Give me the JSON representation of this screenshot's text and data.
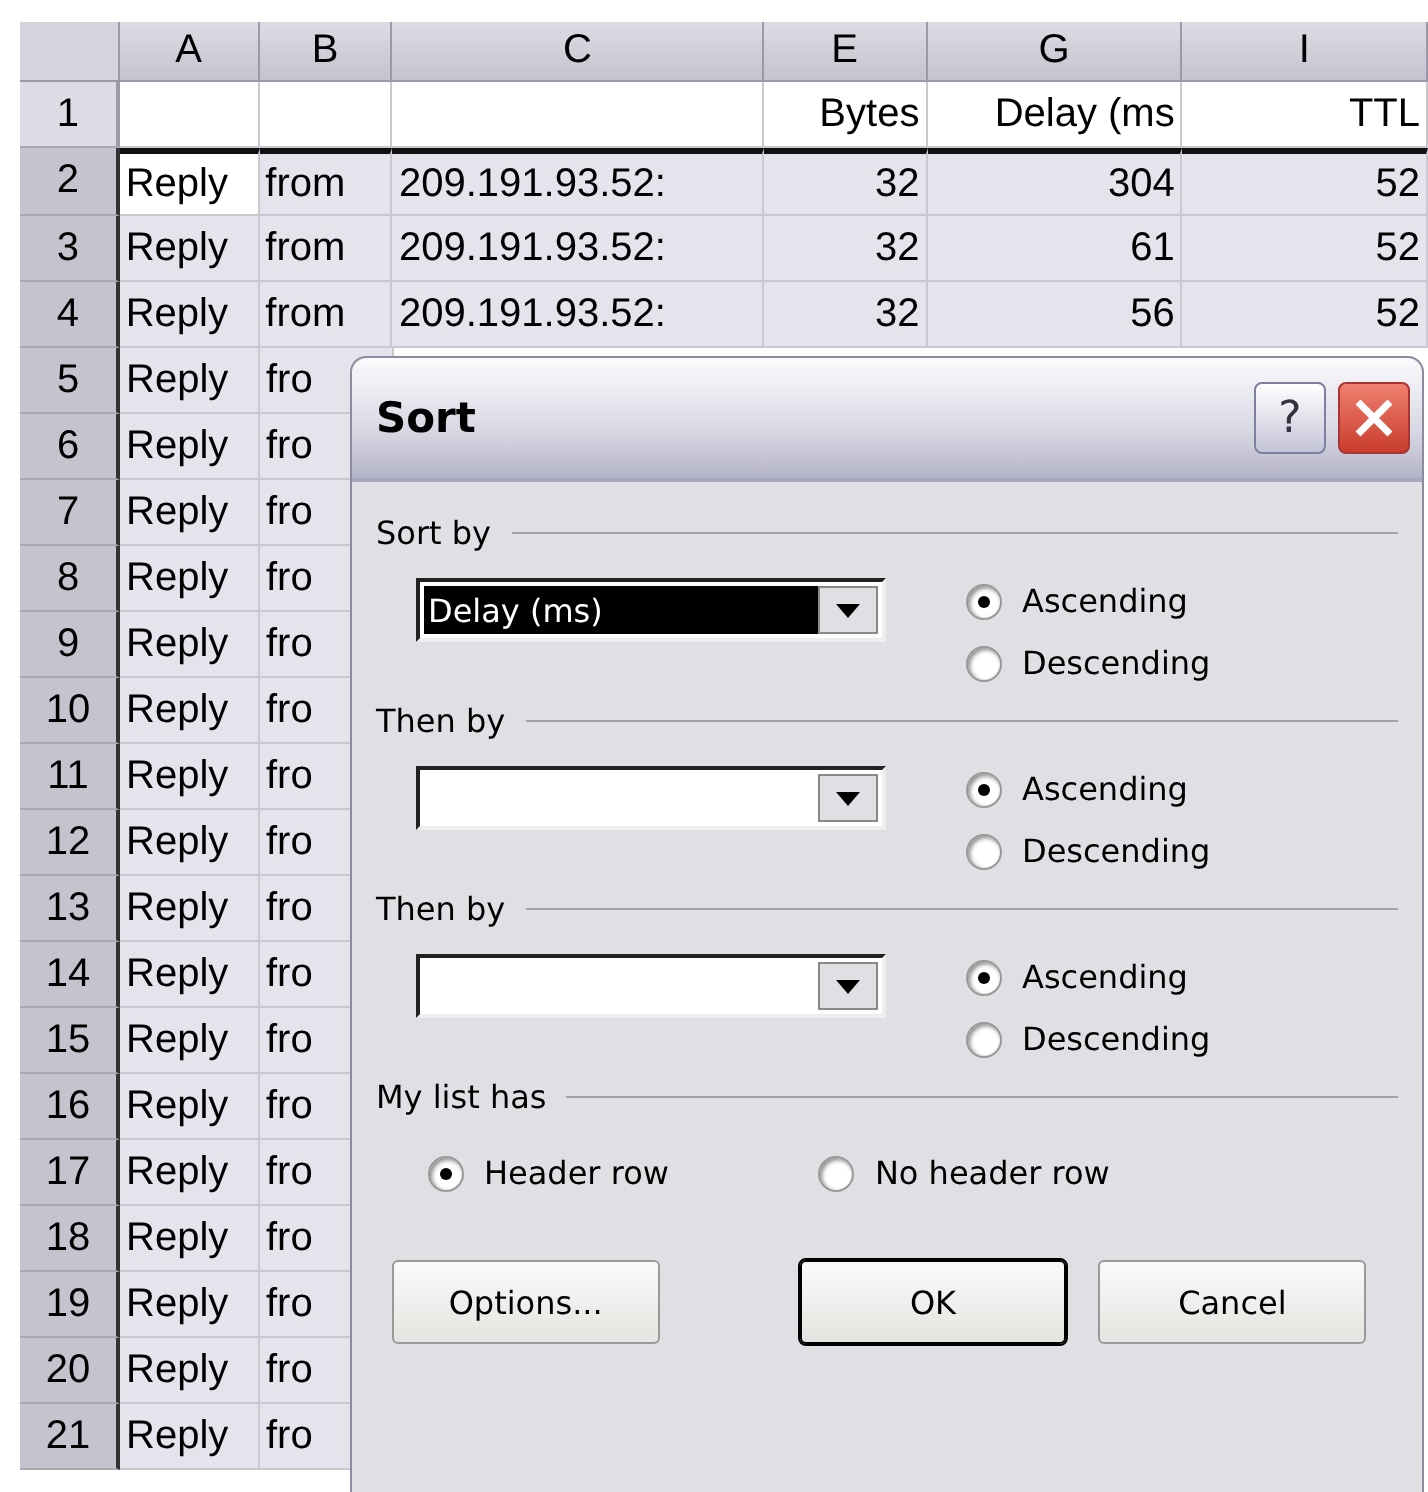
{
  "sheet": {
    "columns": [
      "A",
      "B",
      "C",
      "E",
      "G",
      "I"
    ],
    "rows": [
      {
        "number": "1",
        "selected": false,
        "cells": [
          null,
          null,
          null,
          "Bytes",
          "Delay (ms",
          "TTL"
        ]
      },
      {
        "number": "2",
        "selected": true,
        "active": true,
        "cells": [
          "Reply",
          "from",
          "209.191.93.52:",
          "32",
          "304",
          "52"
        ]
      },
      {
        "number": "3",
        "selected": true,
        "cells": [
          "Reply",
          "from",
          "209.191.93.52:",
          "32",
          "61",
          "52"
        ]
      },
      {
        "number": "4",
        "selected": true,
        "cells": [
          "Reply",
          "from",
          "209.191.93.52:",
          "32",
          "56",
          "52"
        ]
      },
      {
        "number": "5",
        "selected": true,
        "cells": [
          "Reply",
          "fro"
        ]
      },
      {
        "number": "6",
        "selected": true,
        "cells": [
          "Reply",
          "fro"
        ]
      },
      {
        "number": "7",
        "selected": true,
        "cells": [
          "Reply",
          "fro"
        ]
      },
      {
        "number": "8",
        "selected": true,
        "cells": [
          "Reply",
          "fro"
        ]
      },
      {
        "number": "9",
        "selected": true,
        "cells": [
          "Reply",
          "fro"
        ]
      },
      {
        "number": "10",
        "selected": true,
        "cells": [
          "Reply",
          "fro"
        ]
      },
      {
        "number": "11",
        "selected": true,
        "cells": [
          "Reply",
          "fro"
        ]
      },
      {
        "number": "12",
        "selected": true,
        "cells": [
          "Reply",
          "fro"
        ]
      },
      {
        "number": "13",
        "selected": true,
        "cells": [
          "Reply",
          "fro"
        ]
      },
      {
        "number": "14",
        "selected": true,
        "cells": [
          "Reply",
          "fro"
        ]
      },
      {
        "number": "15",
        "selected": true,
        "cells": [
          "Reply",
          "fro"
        ]
      },
      {
        "number": "16",
        "selected": true,
        "cells": [
          "Reply",
          "fro"
        ]
      },
      {
        "number": "17",
        "selected": true,
        "cells": [
          "Reply",
          "fro"
        ]
      },
      {
        "number": "18",
        "selected": true,
        "cells": [
          "Reply",
          "fro"
        ]
      },
      {
        "number": "19",
        "selected": true,
        "cells": [
          "Reply",
          "fro"
        ]
      },
      {
        "number": "20",
        "selected": true,
        "cells": [
          "Reply",
          "fro"
        ]
      },
      {
        "number": "21",
        "selected": true,
        "cells": [
          "Reply",
          "fro"
        ]
      }
    ]
  },
  "dialog": {
    "title": "Sort",
    "help": "?",
    "sort_keys": [
      {
        "heading": "Sort by",
        "field": {
          "value": "Delay (ms)",
          "highlighted": true
        },
        "options": [
          {
            "label": "Ascending",
            "selected": true
          },
          {
            "label": "Descending",
            "selected": false
          }
        ]
      },
      {
        "heading": "Then by",
        "options": [
          {
            "label": "Ascending",
            "selected": true
          },
          {
            "label": "Descending",
            "selected": false
          }
        ]
      },
      {
        "heading": "Then by",
        "options": [
          {
            "label": "Ascending",
            "selected": true
          },
          {
            "label": "Descending",
            "selected": false
          }
        ]
      }
    ],
    "list_has": {
      "heading": "My list has",
      "options": [
        {
          "label": "Header row",
          "selected": true
        },
        {
          "label": "No header row",
          "selected": false
        }
      ]
    },
    "buttons": [
      {
        "label": "Options...",
        "default": false
      },
      {
        "label": "OK",
        "default": true
      },
      {
        "label": "Cancel",
        "default": false
      }
    ]
  }
}
